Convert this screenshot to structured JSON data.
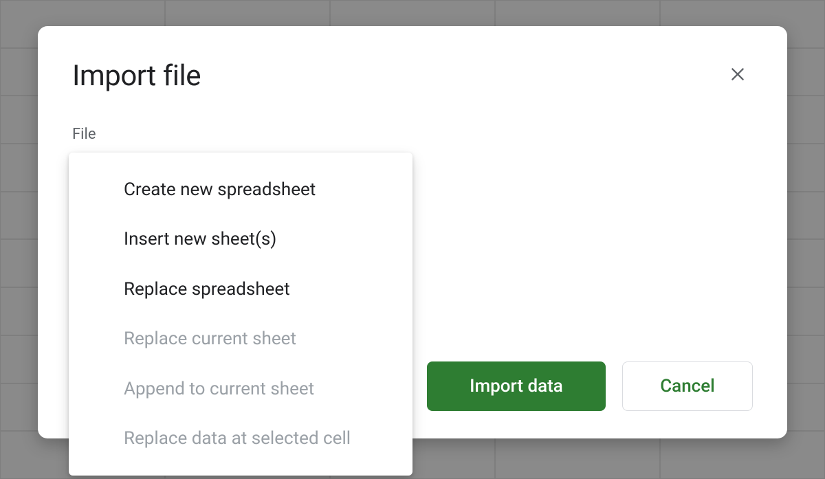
{
  "dialog": {
    "title": "Import file",
    "section_label": "File",
    "import_button": "Import data",
    "cancel_button": "Cancel"
  },
  "dropdown": {
    "items": [
      {
        "label": "Create new spreadsheet",
        "enabled": true
      },
      {
        "label": "Insert new sheet(s)",
        "enabled": true
      },
      {
        "label": "Replace spreadsheet",
        "enabled": true
      },
      {
        "label": "Replace current sheet",
        "enabled": false
      },
      {
        "label": "Append to current sheet",
        "enabled": false
      },
      {
        "label": "Replace data at selected cell",
        "enabled": false
      }
    ]
  }
}
